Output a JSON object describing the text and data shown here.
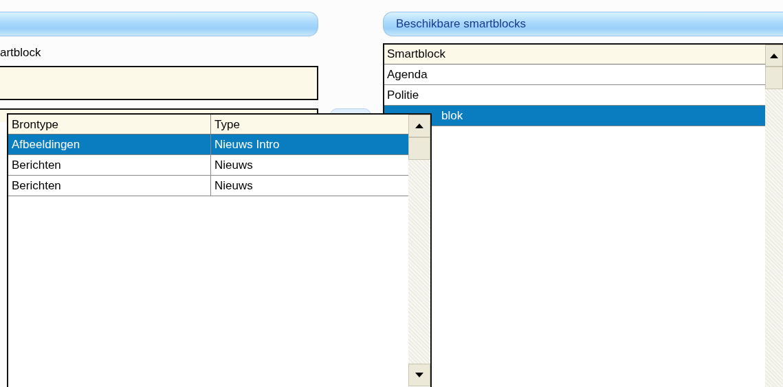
{
  "left_panel": {
    "label": "artblock"
  },
  "dropdown_popup": {
    "columns": [
      "Brontype",
      "Type"
    ],
    "rows": [
      {
        "cells": [
          "Afbeeldingen",
          "Nieuws Intro"
        ],
        "selected": true
      },
      {
        "cells": [
          "Berichten",
          "Nieuws"
        ],
        "selected": false
      },
      {
        "cells": [
          "Berichten",
          "Nieuws"
        ],
        "selected": false
      }
    ]
  },
  "right_panel": {
    "title": "Beschikbare smartblocks",
    "list": {
      "column": "Smartblock",
      "rows": [
        {
          "text": "Agenda",
          "selected": false
        },
        {
          "text": "Politie",
          "selected": false
        },
        {
          "text": "blok",
          "selected": true
        }
      ]
    }
  }
}
